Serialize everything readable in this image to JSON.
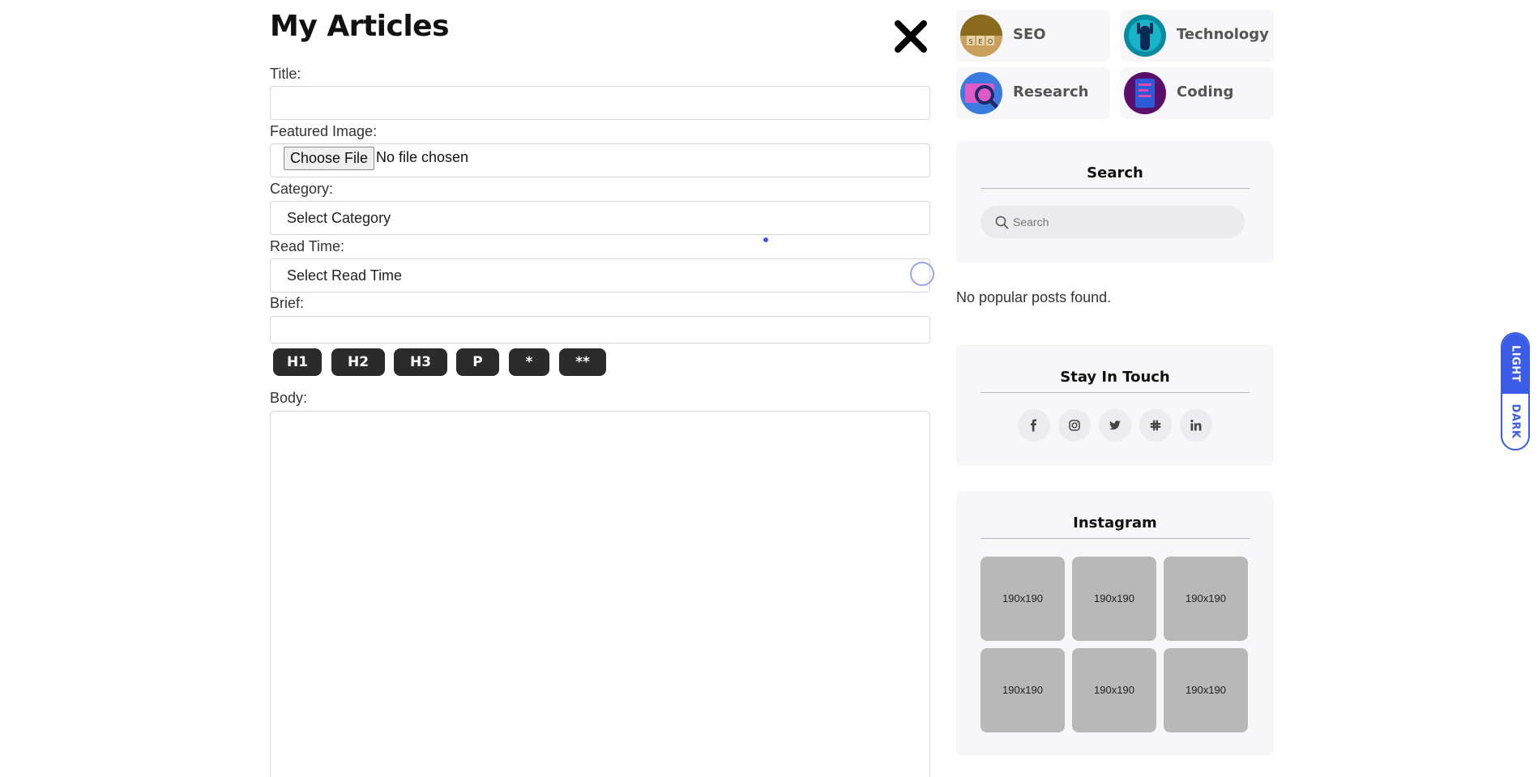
{
  "page": {
    "title": "My Articles"
  },
  "form": {
    "title_label": "Title:",
    "title_value": "",
    "image_label": "Featured Image:",
    "file_button": "Choose File",
    "file_status": "No file chosen",
    "category_label": "Category:",
    "category_value": "Select Category",
    "readtime_label": "Read Time:",
    "readtime_value": "Select Read Time",
    "brief_label": "Brief:",
    "brief_value": "",
    "format_buttons": [
      "H1",
      "H2",
      "H3",
      "P",
      "*",
      "**"
    ],
    "body_label": "Body:",
    "body_value": ""
  },
  "categories": [
    {
      "label": "SEO",
      "icon": "seo-thumbnail"
    },
    {
      "label": "Technology",
      "icon": "technology-thumbnail"
    },
    {
      "label": "Research",
      "icon": "research-thumbnail"
    },
    {
      "label": "Coding",
      "icon": "coding-thumbnail"
    }
  ],
  "search": {
    "title": "Search",
    "placeholder": "Search"
  },
  "popular": {
    "empty_text": "No popular posts found."
  },
  "social": {
    "title": "Stay In Touch",
    "items": [
      "facebook-icon",
      "instagram-icon",
      "twitter-icon",
      "slack-icon",
      "linkedin-icon"
    ]
  },
  "instagram": {
    "title": "Instagram",
    "tiles": [
      "190x190",
      "190x190",
      "190x190",
      "190x190",
      "190x190",
      "190x190"
    ]
  },
  "theme": {
    "light_label": "LIGHT",
    "dark_label": "DARK",
    "active": "LIGHT"
  },
  "colors": {
    "accent": "#3b5ce6",
    "button_dark": "#2b2b2b",
    "widget_bg": "#f7f7f9"
  }
}
